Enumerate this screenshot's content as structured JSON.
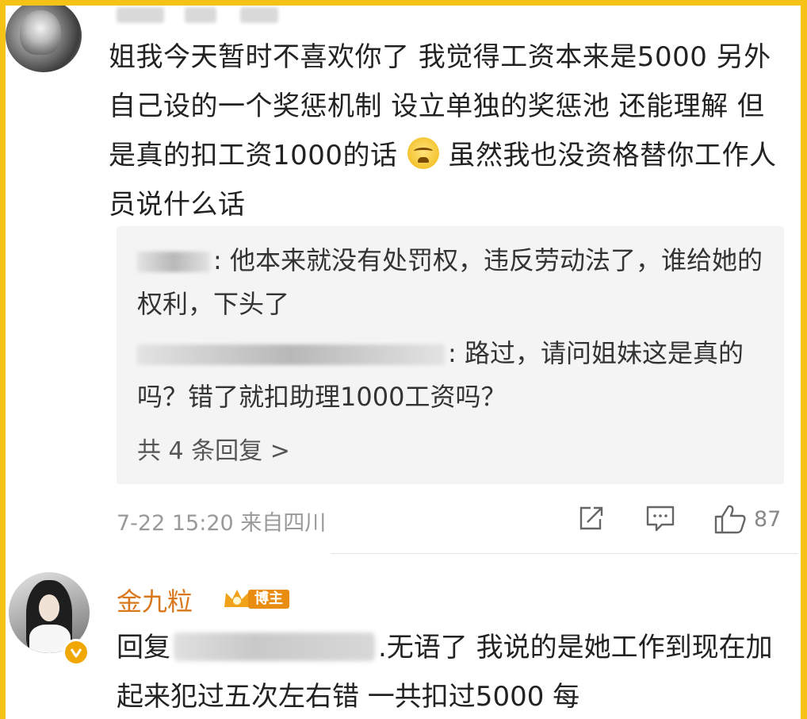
{
  "comment1": {
    "text": "姐我今天暂时不喜欢你了 我觉得工资本来是5000 另外自己设的一个奖惩机制 设立单独的奖惩池 还能理解 但是真的扣工资1000的话",
    "text_after_emoji": "虽然我也没资格替你工作人员说什么话",
    "emoji": "crying-face-icon",
    "replies": [
      {
        "text": ": 他本来就没有处罚权，违反劳动法了，谁给她的权利，下头了"
      },
      {
        "text": ": 路过，请问姐妹这是真的吗？错了就扣助理1000工资吗？"
      }
    ],
    "more_replies": "共 4 条回复 >",
    "time_source": "7-22 15:20 来自四川",
    "like_count": "87"
  },
  "comment2": {
    "author": "金九粒",
    "badge": "博主",
    "reply_prefix": "回复",
    "text": ".无语了 我说的是她工作到现在加起来犯过五次左右错 一共扣过5000 每"
  },
  "colors": {
    "border": "#f6c218",
    "author_name": "#d9771c",
    "reply_background": "#f4f4f4"
  }
}
